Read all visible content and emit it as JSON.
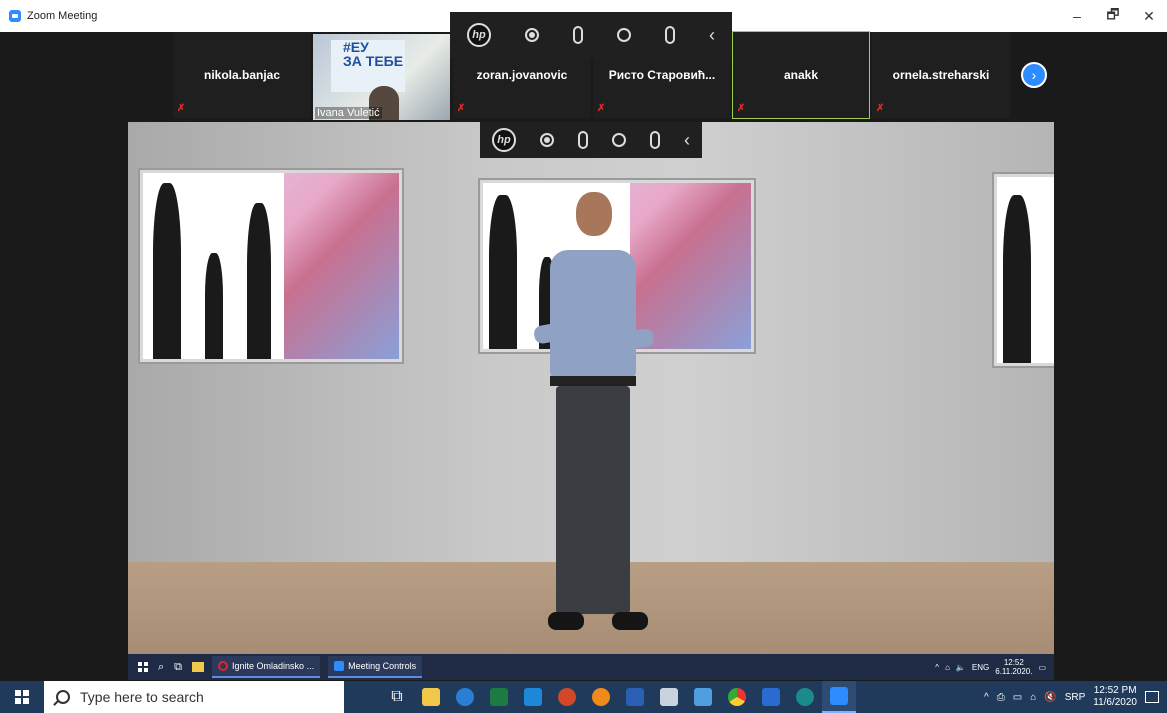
{
  "window": {
    "title": "Zoom Meeting",
    "minimize": "–",
    "maximize": "🗗",
    "close": "✕"
  },
  "gallery": {
    "participants": [
      {
        "name": "nikola.banjac"
      },
      {
        "name": "Ivana Vuletić",
        "sign_line1": "#ЕУ",
        "sign_line2": "ЗА ТЕБЕ"
      },
      {
        "name": "zoran.jovanovic"
      },
      {
        "name": "Ристо Старовић..."
      },
      {
        "name": "anakk"
      },
      {
        "name": "ornela.streharski"
      }
    ],
    "next": "›"
  },
  "hp_toolbar": {
    "logo": "hp",
    "back": "‹"
  },
  "inner_taskbar": {
    "apps": [
      "Ignite Omladinsko ...",
      "Meeting Controls"
    ],
    "lang": "ENG",
    "time": "12:52",
    "date": "6.11.2020."
  },
  "taskbar": {
    "search_placeholder": "Type here to search",
    "lang": "SRP",
    "time": "12:52 PM",
    "date": "11/6/2020"
  },
  "colors": {
    "zoom_blue": "#2d8cff",
    "taskbar": "#203a5c",
    "active_speaker": "#9bd04a"
  }
}
